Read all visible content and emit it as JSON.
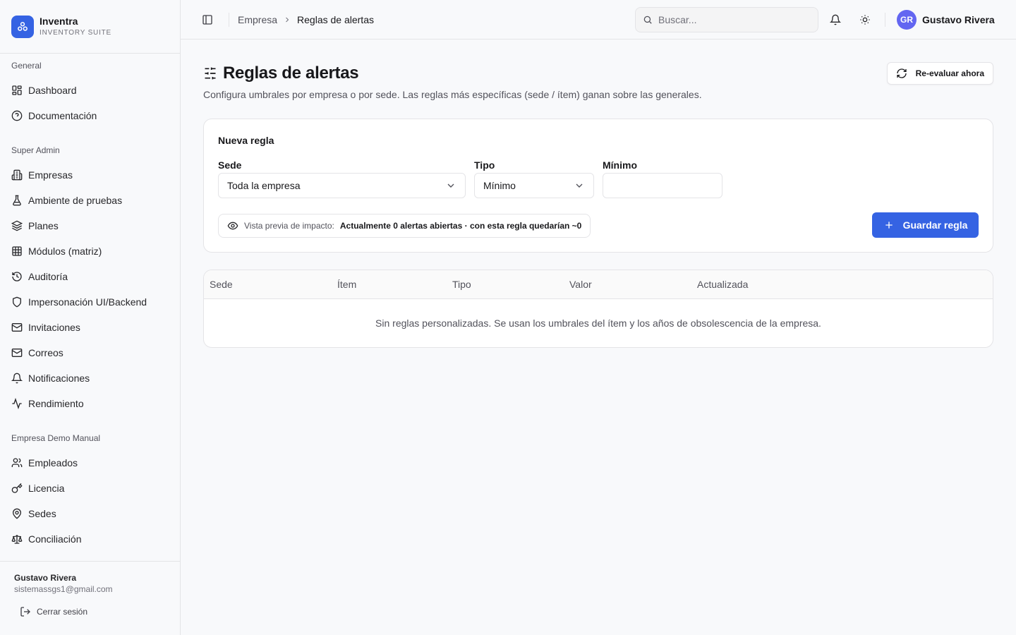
{
  "brand": {
    "name": "Inventra",
    "subtitle": "INVENTORY SUITE"
  },
  "nav": {
    "groups": [
      {
        "title": "General",
        "items": [
          {
            "label": "Dashboard",
            "icon": "layout-grid-icon"
          },
          {
            "label": "Documentación",
            "icon": "help-circle-icon"
          }
        ]
      },
      {
        "title": "Super Admin",
        "items": [
          {
            "label": "Empresas",
            "icon": "building-icon"
          },
          {
            "label": "Ambiente de pruebas",
            "icon": "flask-icon"
          },
          {
            "label": "Planes",
            "icon": "layers-icon"
          },
          {
            "label": "Módulos (matriz)",
            "icon": "table-icon"
          },
          {
            "label": "Auditoría",
            "icon": "history-icon"
          },
          {
            "label": "Impersonación UI/Backend",
            "icon": "shield-icon"
          },
          {
            "label": "Invitaciones",
            "icon": "mail-icon"
          },
          {
            "label": "Correos",
            "icon": "mail-icon"
          },
          {
            "label": "Notificaciones",
            "icon": "bell-icon"
          },
          {
            "label": "Rendimiento",
            "icon": "activity-icon"
          }
        ]
      },
      {
        "title": "Empresa Demo Manual",
        "items": [
          {
            "label": "Empleados",
            "icon": "users-icon"
          },
          {
            "label": "Licencia",
            "icon": "key-icon"
          },
          {
            "label": "Sedes",
            "icon": "map-pin-icon"
          },
          {
            "label": "Conciliación",
            "icon": "scale-icon"
          }
        ]
      }
    ]
  },
  "sidebar_footer": {
    "name": "Gustavo Rivera",
    "email": "sistemassgs1@gmail.com",
    "logout_label": "Cerrar sesión"
  },
  "topbar": {
    "breadcrumb": [
      "Empresa",
      "Reglas de alertas"
    ],
    "search_placeholder": "Buscar...",
    "user_initials": "GR",
    "user_name": "Gustavo Rivera"
  },
  "page": {
    "title": "Reglas de alertas",
    "description": "Configura umbrales por empresa o por sede. Las reglas más específicas (sede / ítem) ganan sobre las generales.",
    "reevaluate_label": "Re-evaluar ahora"
  },
  "new_rule": {
    "title": "Nueva regla",
    "sede_label": "Sede",
    "sede_value": "Toda la empresa",
    "tipo_label": "Tipo",
    "tipo_value": "Mínimo",
    "minimo_label": "Mínimo",
    "minimo_value": "",
    "impact_label": "Vista previa de impacto:",
    "impact_value": "Actualmente 0 alertas abiertas · con esta regla quedarían ~0",
    "save_label": "Guardar regla"
  },
  "rules_table": {
    "columns": [
      "Sede",
      "Ítem",
      "Tipo",
      "Valor",
      "Actualizada"
    ],
    "empty_message": "Sin reglas personalizadas. Se usan los umbrales del ítem y los años de obsolescencia de la empresa."
  },
  "colors": {
    "accent": "#3563e3",
    "avatar": "#6366f1",
    "border": "#e4e4e7",
    "background": "#f8f9fb"
  }
}
